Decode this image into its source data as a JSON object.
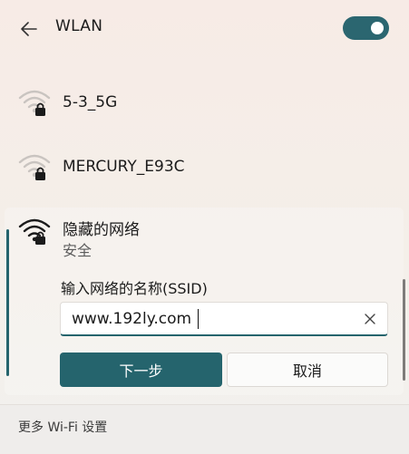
{
  "header": {
    "back_icon": "arrow-left-icon",
    "title": "WLAN",
    "wlan_toggle": "on",
    "accent_color": "#2b6670"
  },
  "networks": [
    {
      "name": "5-3_5G",
      "icon": "wifi-lock-icon"
    },
    {
      "name": "MERCURY_E93C",
      "icon": "wifi-lock-icon"
    }
  ],
  "hidden_network": {
    "name": "隐藏的网络",
    "status": "安全",
    "icon": "wifi-lock-icon",
    "ssid_label": "输入网络的名称(SSID)",
    "ssid_value": "www.192ly.com",
    "clear_icon": "close-icon",
    "next_label": "下一步",
    "cancel_label": "取消"
  },
  "footer": {
    "more_settings": "更多 Wi-Fi 设置"
  }
}
